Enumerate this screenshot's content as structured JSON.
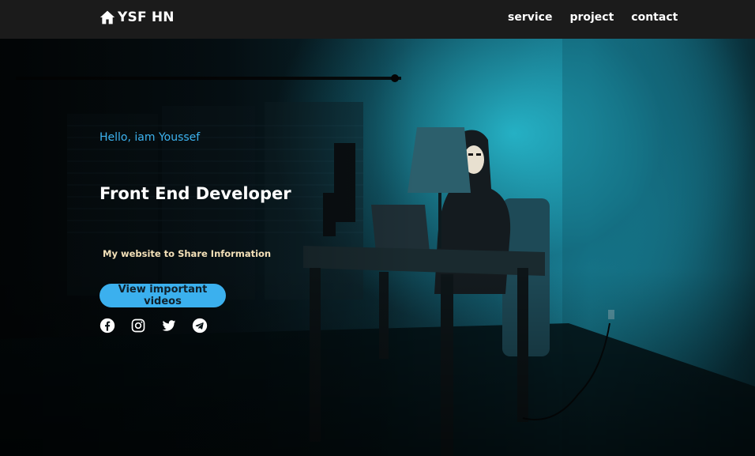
{
  "nav": {
    "logo_text": "YSF HN",
    "logo_icon": "home-icon",
    "links": [
      {
        "label": "service"
      },
      {
        "label": "project"
      },
      {
        "label": "contact"
      }
    ]
  },
  "hero": {
    "greeting": "Hello, iam Youssef",
    "headline": "Front End Developer",
    "subline": "My website to Share Information",
    "cta_label": "View important videos",
    "socials": [
      {
        "icon": "facebook-icon"
      },
      {
        "icon": "instagram-icon"
      },
      {
        "icon": "twitter-icon"
      },
      {
        "icon": "telegram-icon"
      }
    ]
  },
  "colors": {
    "navbar_bg": "#1b1b1b",
    "accent": "#3bb0ee",
    "greeting": "#3db3f0",
    "subline": "#f3e0b8"
  }
}
